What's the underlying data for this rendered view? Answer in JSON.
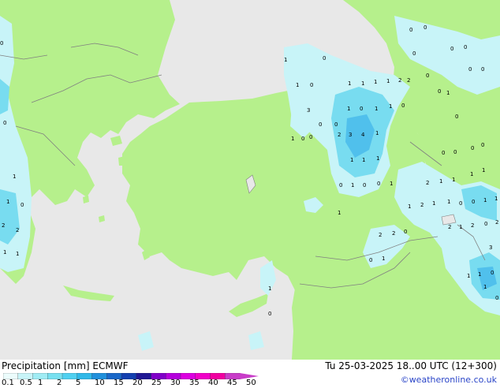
{
  "title": "Precipitation [mm]",
  "model": "ECMWF",
  "run": "Tu 25-03-2025 18..00 UTC (12+300)",
  "credit": "©weatheronline.co.uk",
  "legend": {
    "ticks": [
      "0.1",
      "0.5",
      "1",
      "2",
      "5",
      "10",
      "15",
      "20",
      "25",
      "30",
      "35",
      "40",
      "45",
      "50"
    ],
    "colors": [
      "#ecfcfc",
      "#c8f4f8",
      "#a0ecf4",
      "#78e0f0",
      "#50d0f0",
      "#30b8e8",
      "#2090dc",
      "#1a68c8",
      "#1440b0",
      "#201894",
      "#8000c8",
      "#b400dc",
      "#dc00e0",
      "#f000c8",
      "#f000a0",
      "#c83cc8"
    ]
  },
  "map": {
    "land_color": "#b6f08c",
    "sea_color": "#e8e8e8",
    "border_color": "#808080",
    "precip_light": "#c8f4f8",
    "precip_mid": "#78dcf0",
    "precip_heavy": "#50c0ec"
  },
  "cell_labels": [
    "0",
    "0",
    "0",
    "0",
    "0",
    "0",
    "1",
    "0",
    "1",
    "0",
    "1",
    "1",
    "1",
    "1",
    "2",
    "2",
    "1",
    "0",
    "1",
    "0",
    "1",
    "3",
    "4",
    "1",
    "2",
    "3",
    "0",
    "1",
    "1",
    "1",
    "0",
    "1",
    "0",
    "0",
    "1",
    "1",
    "1",
    "2",
    "1",
    "1",
    "0",
    "0",
    "1",
    "1",
    "2",
    "2",
    "0",
    "2",
    "1",
    "2",
    "0",
    "2",
    "3",
    "1",
    "1",
    "0",
    "1",
    "0",
    "1",
    "0",
    "0",
    "0",
    "0",
    "1",
    "2",
    "1",
    "1",
    "1",
    "1",
    "0",
    "0",
    "0",
    "0",
    "1",
    "0",
    "0",
    "0",
    "0",
    "0",
    "0",
    "1",
    "1",
    "0",
    "2",
    "2",
    "1",
    "1",
    "1",
    "0"
  ]
}
